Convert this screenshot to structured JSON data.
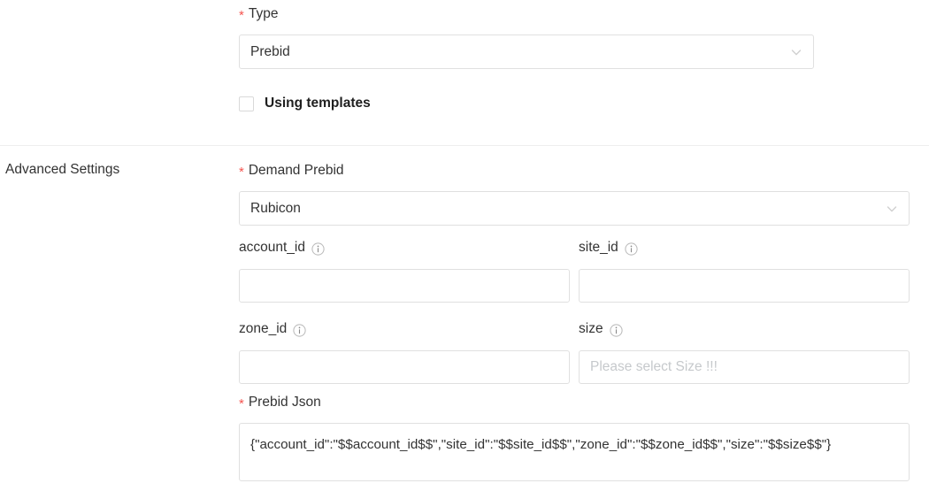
{
  "form": {
    "type_section": {
      "label": "Type",
      "required_marker": "*",
      "select_value": "Prebid",
      "chevron_icon": "chevron-down-icon",
      "checkbox": {
        "label": "Using templates",
        "checked": false
      }
    },
    "advanced_settings": {
      "section_title": "Advanced Settings",
      "demand_prebid": {
        "label": "Demand Prebid",
        "required_marker": "*",
        "select_value": "Rubicon",
        "chevron_icon": "chevron-down-icon"
      },
      "fields": [
        {
          "label": "account_id",
          "info_icon": "info-circle-icon",
          "value": "",
          "placeholder": ""
        },
        {
          "label": "site_id",
          "info_icon": "info-circle-icon",
          "value": "",
          "placeholder": ""
        },
        {
          "label": "zone_id",
          "info_icon": "info-circle-icon",
          "value": "",
          "placeholder": ""
        },
        {
          "label": "size",
          "info_icon": "info-circle-icon",
          "value": "",
          "placeholder": "Please select Size !!!"
        }
      ],
      "prebid_json": {
        "label": "Prebid Json",
        "required_marker": "*",
        "value": "{\"account_id\":\"$$account_id$$\",\"site_id\":\"$$site_id$$\",\"zone_id\":\"$$zone_id$$\",\"size\":\"$$size$$\"}"
      }
    }
  },
  "colors": {
    "required_asterisk": "#f5544f",
    "border": "#e0e0e0",
    "divider": "#eeeeee",
    "text": "#333333",
    "placeholder": "#c6c9cc",
    "icon_gray": "#9a9a9a"
  }
}
